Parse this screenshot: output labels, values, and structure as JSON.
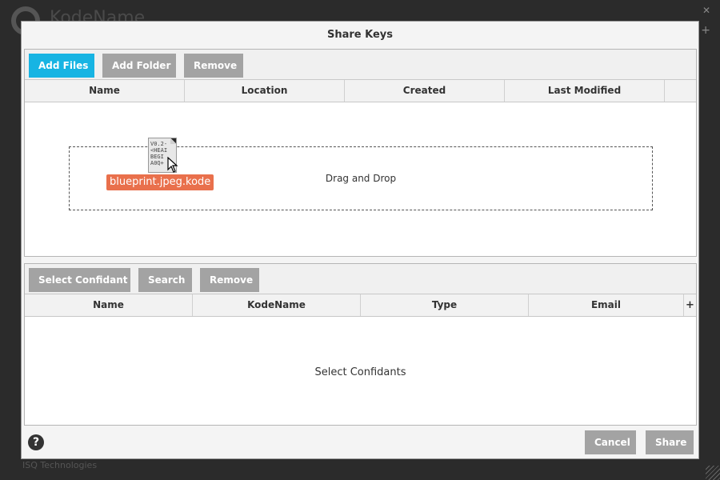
{
  "background": {
    "app_name": "KodeName",
    "footer_text": "ISQ Technologies"
  },
  "dialog": {
    "title": "Share Keys"
  },
  "files_panel": {
    "buttons": {
      "add_files": "Add Files",
      "add_folder": "Add Folder",
      "remove": "Remove"
    },
    "columns": [
      "Name",
      "Location",
      "Created",
      "Last Modified"
    ],
    "drop_zone_text": "Drag and Drop",
    "dragged_file": {
      "label": "blueprint.jpeg.kode",
      "thumbnail_lines": [
        "V0.2-",
        "<HEAI",
        "BEGI",
        "A0Q+"
      ]
    }
  },
  "confidants_panel": {
    "buttons": {
      "select_confidant": "Select Confidant",
      "search": "Search",
      "remove": "Remove"
    },
    "columns": [
      "Name",
      "KodeName",
      "Type",
      "Email"
    ],
    "add_column_icon": "plus-icon",
    "empty_text": "Select Confidants"
  },
  "footer": {
    "help_icon": "help-icon",
    "help_glyph": "?",
    "cancel": "Cancel",
    "share": "Share"
  },
  "colors": {
    "primary_button": "#17b4e3",
    "secondary_button": "#a3a3a3",
    "drag_label": "#e9704c"
  }
}
